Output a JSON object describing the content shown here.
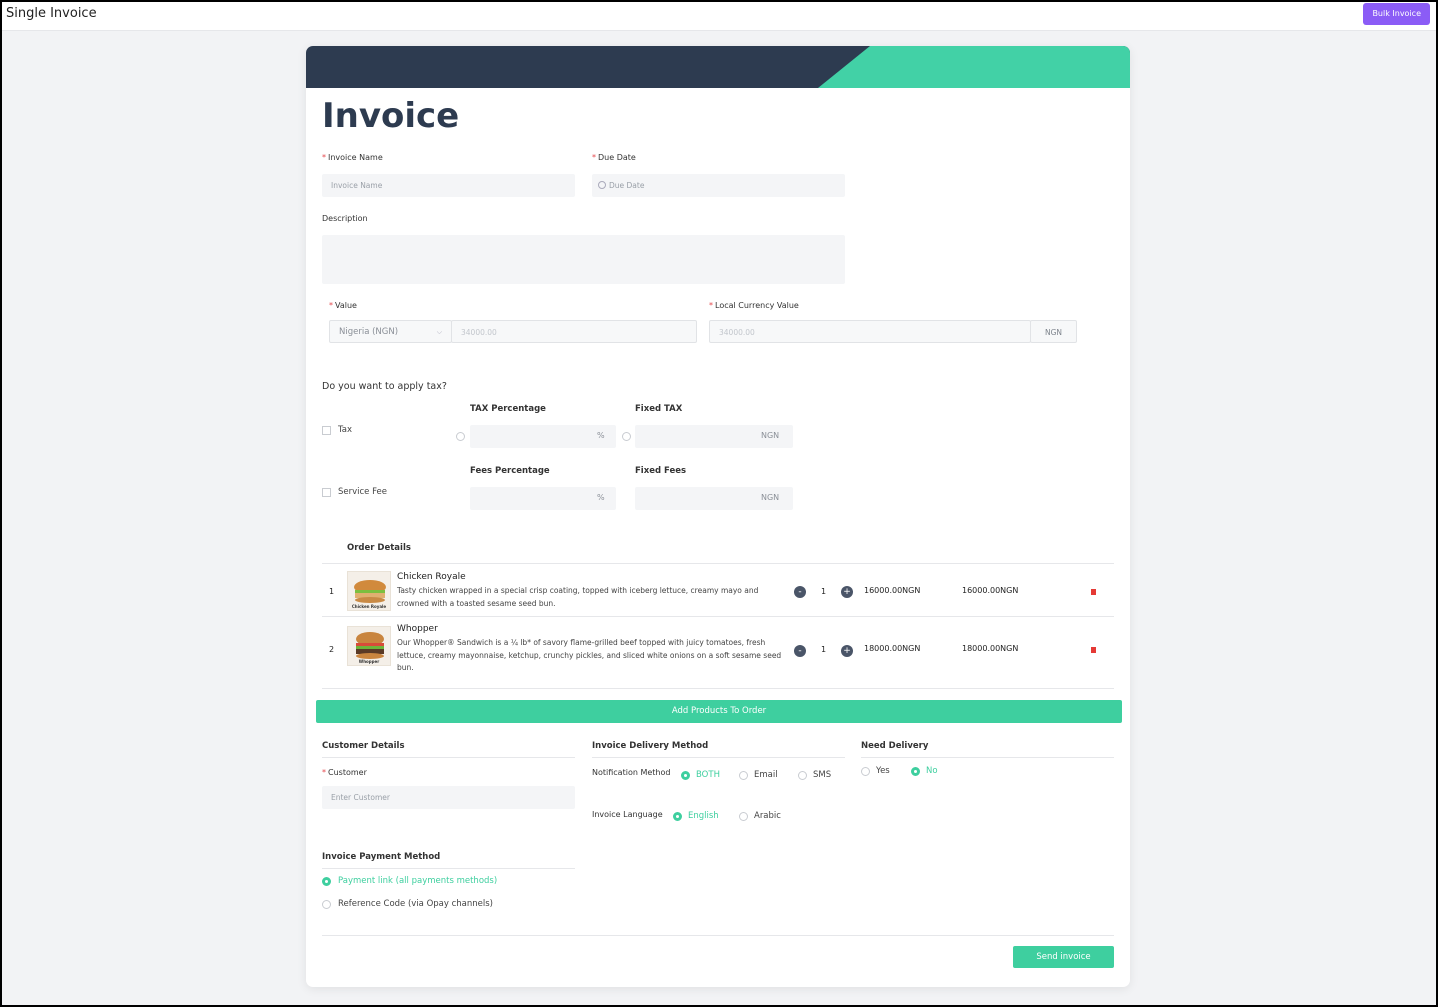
{
  "header": {
    "title": "Single Invoice",
    "bulk_button": "Bulk Invoice"
  },
  "form": {
    "heading": "Invoice",
    "invoice_name": {
      "label": "Invoice Name",
      "placeholder": "Invoice Name"
    },
    "due_date": {
      "label": "Due Date",
      "placeholder": "Due Date"
    },
    "description": {
      "label": "Description"
    },
    "value": {
      "label": "Value",
      "country": "Nigeria  (NGN)",
      "amount": "34000.00"
    },
    "local_currency": {
      "label": "Local Currency Value",
      "amount": "34000.00",
      "currency": "NGN"
    },
    "tax_question": "Do you want to apply tax?",
    "tax": {
      "checkbox_label": "Tax",
      "percentage_label": "TAX Percentage",
      "percent_symbol": "%",
      "fixed_label": "Fixed TAX",
      "fixed_currency": "NGN"
    },
    "service_fee": {
      "checkbox_label": "Service Fee",
      "percentage_label": "Fees Percentage",
      "percent_symbol": "%",
      "fixed_label": "Fixed Fees",
      "fixed_currency": "NGN"
    }
  },
  "order": {
    "title": "Order Details",
    "items": [
      {
        "index": "1",
        "name": "Chicken Royale",
        "description": "Tasty chicken wrapped in a special crisp coating, topped with iceberg lettuce, creamy mayo and crowned with a toasted sesame seed bun.",
        "thumb_caption": "Chicken Royale",
        "qty": "1",
        "unit_price": "16000.00NGN",
        "total": "16000.00NGN"
      },
      {
        "index": "2",
        "name": "Whopper",
        "description": "Our Whopper® Sandwich is a ¼ lb* of savory flame-grilled beef topped with juicy tomatoes, fresh lettuce, creamy mayonnaise, ketchup, crunchy pickles, and sliced white onions on a soft sesame seed bun.",
        "thumb_caption": "Whopper",
        "qty": "1",
        "unit_price": "18000.00NGN",
        "total": "18000.00NGN"
      }
    ],
    "add_button": "Add Products To Order"
  },
  "customer": {
    "title": "Customer Details",
    "label": "Customer",
    "placeholder": "Enter Customer"
  },
  "delivery_method": {
    "title": "Invoice Delivery Method",
    "notification_label": "Notification Method",
    "notification_options": [
      "BOTH",
      "Email",
      "SMS"
    ],
    "notification_selected": "BOTH",
    "language_label": "Invoice Language",
    "language_options": [
      "English",
      "Arabic"
    ],
    "language_selected": "English"
  },
  "need_delivery": {
    "title": "Need Delivery",
    "options": [
      "Yes",
      "No"
    ],
    "selected": "No"
  },
  "payment_method": {
    "title": "Invoice Payment Method",
    "options": [
      "Payment link (all payments methods)",
      "Reference Code (via Opay channels)"
    ],
    "selected": "Payment link (all payments methods)"
  },
  "send_button": "Send invoice",
  "colors": {
    "accent": "#3ecf9f",
    "banner_dark": "#2d3b50",
    "bulk": "#8b5cf6",
    "delete": "#e53935"
  }
}
